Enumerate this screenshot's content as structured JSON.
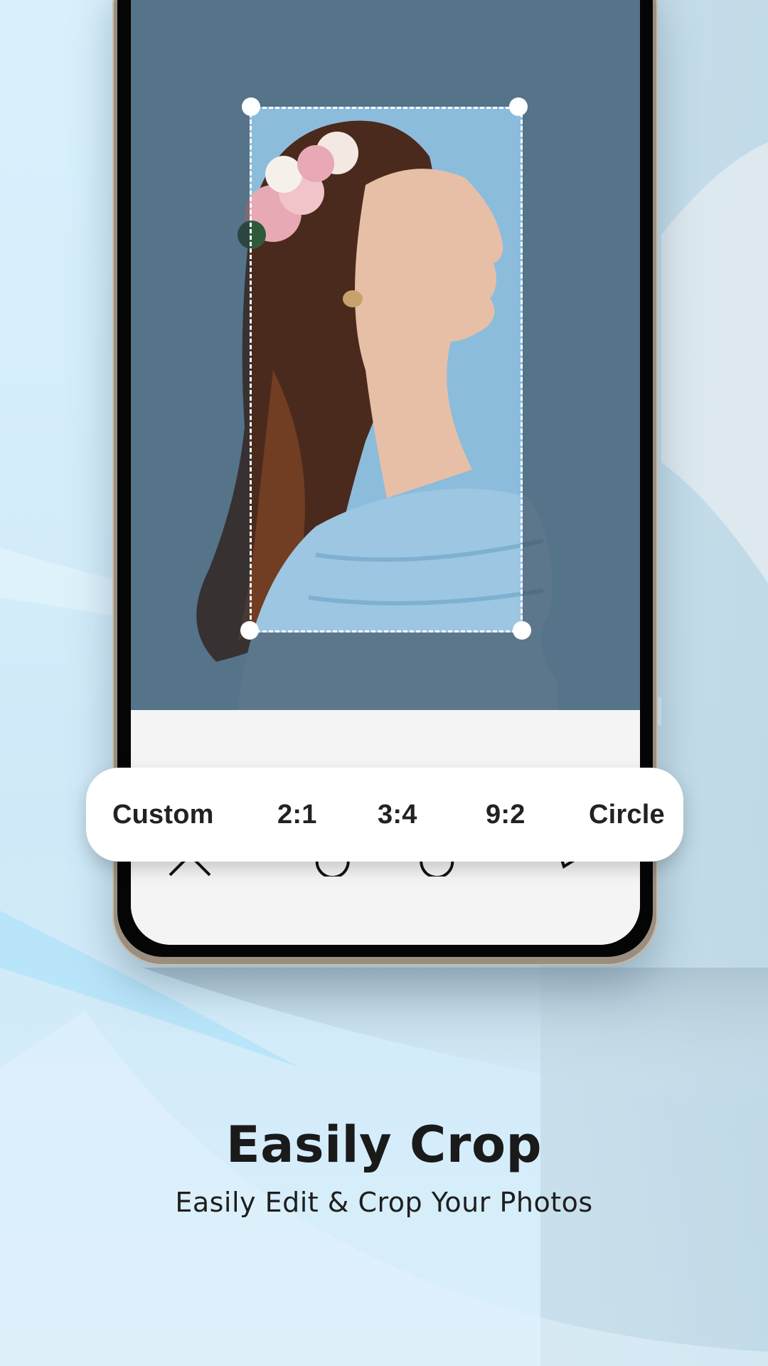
{
  "editor": {
    "ratio_options": [
      {
        "label": "Custom",
        "selected": true
      },
      {
        "label": "2:1",
        "selected": false
      },
      {
        "label": "3:4",
        "selected": false
      },
      {
        "label": "9:2",
        "selected": false
      },
      {
        "label": "Circle",
        "selected": false
      }
    ],
    "toolbar": {
      "cancel_icon": "close-icon",
      "rotate_right_icon": "rotate-clockwise-icon",
      "rotate_left_icon": "rotate-counterclockwise-icon",
      "confirm_icon": "check-icon"
    },
    "photo_description": "Woman in profile with flower crown and light blue ruffled blouse"
  },
  "promo": {
    "title": "Easily Crop",
    "subtitle": "Easily Edit & Crop Your Photos"
  },
  "colors": {
    "background": "#d6eefa",
    "pill": "#ffffff",
    "text": "#1a1a1a",
    "toolbar": "#f4f4f4",
    "crop_outline": "#ffffff"
  }
}
